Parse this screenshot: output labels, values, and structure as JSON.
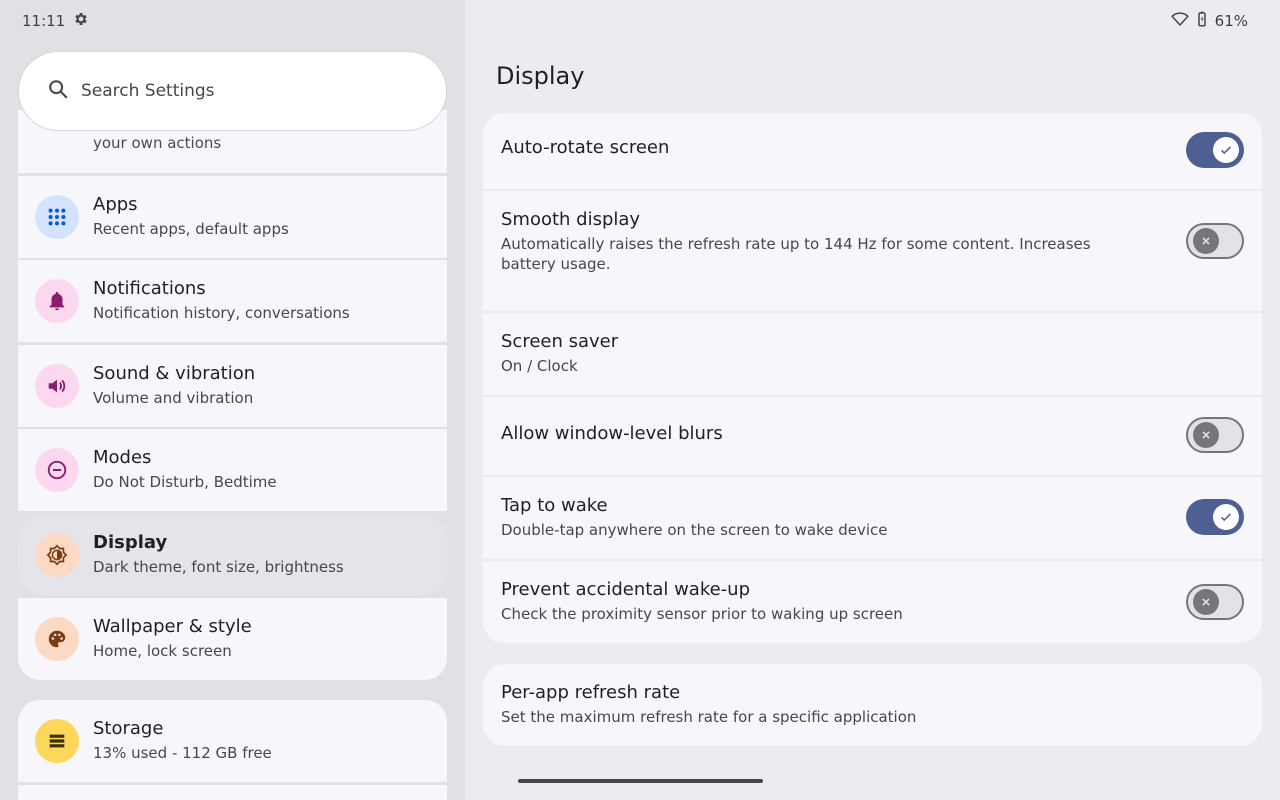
{
  "status": {
    "time": "11:11",
    "battery": "61%"
  },
  "search": {
    "placeholder": "Search Settings"
  },
  "menu": {
    "partial_sub": "your own actions",
    "items": [
      {
        "title": "Apps",
        "sub": "Recent apps, default apps",
        "icon": "apps-grid-icon",
        "icon_bg": "#d3e3fd",
        "icon_color": "#0b57d0"
      },
      {
        "title": "Notifications",
        "sub": "Notification history, conversations",
        "icon": "bell-icon",
        "icon_bg": "#fbd8ef",
        "icon_color": "#8c1d6b"
      },
      {
        "title": "Sound & vibration",
        "sub": "Volume and vibration",
        "icon": "speaker-icon",
        "icon_bg": "#fbd8ef",
        "icon_color": "#8c1d6b"
      },
      {
        "title": "Modes",
        "sub": "Do Not Disturb, Bedtime",
        "icon": "minus-circle-icon",
        "icon_bg": "#fbd8ef",
        "icon_color": "#8c1d6b"
      },
      {
        "title": "Display",
        "sub": "Dark theme, font size, brightness",
        "icon": "brightness-icon",
        "icon_bg": "#fbd9c3",
        "icon_color": "#7a3a12"
      },
      {
        "title": "Wallpaper & style",
        "sub": "Home, lock screen",
        "icon": "palette-icon",
        "icon_bg": "#fbd9c3",
        "icon_color": "#7a3a12"
      },
      {
        "title": "Storage",
        "sub": "13% used - 112 GB free",
        "icon": "storage-icon",
        "icon_bg": "#fbd75a",
        "icon_color": "#3d2f00"
      }
    ],
    "selected": "Display"
  },
  "page": {
    "title": "Display",
    "settings": [
      {
        "title": "Auto-rotate screen",
        "sub": "",
        "toggle": true
      },
      {
        "title": "Smooth display",
        "sub": "Automatically raises the refresh rate up to 144 Hz for some content. Increases battery usage.",
        "toggle": false
      },
      {
        "title": "Screen saver",
        "sub": "On / Clock",
        "toggle": null
      },
      {
        "title": "Allow window-level blurs",
        "sub": "",
        "toggle": false
      },
      {
        "title": "Tap to wake",
        "sub": "Double-tap anywhere on the screen to wake device",
        "toggle": true
      },
      {
        "title": "Prevent accidental wake-up",
        "sub": "Check the proximity sensor prior to waking up screen",
        "toggle": false
      },
      {
        "title": "Per-app refresh rate",
        "sub": "Set the maximum refresh rate for a specific application",
        "toggle": null
      }
    ]
  },
  "colors": {
    "accent": "#4d5f93",
    "toggle_off": "#75767c"
  }
}
